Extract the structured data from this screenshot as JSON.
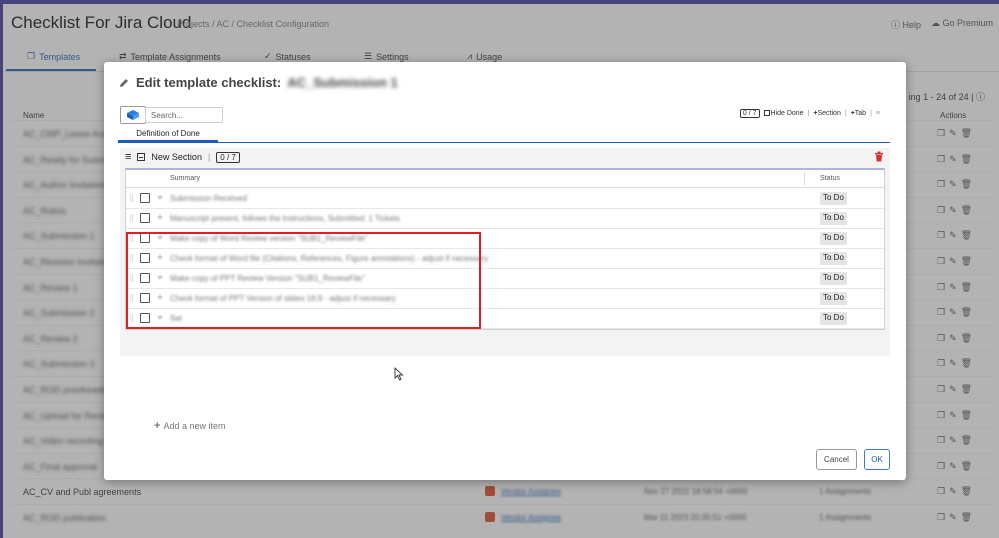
{
  "app": {
    "title": "Checklist For Jira Cloud",
    "breadcrumb": "Projects / AC / Checklist Configuration",
    "help_label": "Help",
    "premium_label": "Go Premium"
  },
  "tabs": [
    {
      "label": "Templates",
      "icon": "copy-icon"
    },
    {
      "label": "Template Assignments",
      "icon": "arrows-icon"
    },
    {
      "label": "Statuses",
      "icon": "check-circle-icon"
    },
    {
      "label": "Settings",
      "icon": "sliders-icon"
    },
    {
      "label": "Usage",
      "icon": "chart-icon"
    }
  ],
  "list": {
    "pager": "ing 1 - 24 of 24",
    "col_name": "Name",
    "col_actions": "Actions",
    "rows": [
      {
        "name": "AC_CMP_Lease Assets"
      },
      {
        "name": "AC_Ready for Submission"
      },
      {
        "name": "AC_Author Invitation"
      },
      {
        "name": "AC_Rubric"
      },
      {
        "name": "AC_Submission 1"
      },
      {
        "name": "AC_Revision Invitation"
      },
      {
        "name": "AC_Review 1"
      },
      {
        "name": "AC_Submission 2"
      },
      {
        "name": "AC_Review 2"
      },
      {
        "name": "AC_Submission 3"
      },
      {
        "name": "AC_ROD proofreading"
      },
      {
        "name": "AC_Upload for Review"
      },
      {
        "name": "AC_Video recording"
      },
      {
        "name": "AC_Final approval"
      },
      {
        "name": "AC_CV and Publ agreements",
        "clear": true,
        "extra1": "Vendor Assignee",
        "extra2": "Nov 27 2022 18:58:54 +0000",
        "extra3": "1 Assignments"
      },
      {
        "name": "AC_ROD publication",
        "extra1": "Vendor Assignee",
        "extra2": "Mar 11 2023 20:35:51 +0000",
        "extra3": "1 Assignments"
      }
    ]
  },
  "modal": {
    "title_prefix": "Edit template checklist:",
    "template_name": "AC_Submission 1",
    "search_placeholder": "Search...",
    "count": "0 / 7",
    "hide_done": "Hide Done",
    "section_btn": "Section",
    "tab_btn": "Tab",
    "dod_tab": "Definition of Done",
    "section_title": "New Section",
    "section_count": "0 / 7",
    "col_summary": "Summary",
    "col_status": "Status",
    "items": [
      {
        "summary": "Submission Received",
        "status": "To Do"
      },
      {
        "summary": "Manuscript present, follows the Instructions, Submitted: 1 Tickets",
        "status": "To Do"
      },
      {
        "summary": "Make copy of Word Review version \"SUB1_ReviewFile\"",
        "status": "To Do"
      },
      {
        "summary": "Check format of Word file (Citations, References, Figure annotations) - adjust if necessary",
        "status": "To Do"
      },
      {
        "summary": "Make copy of PPT Review Version \"SUB1_ReviewFile\"",
        "status": "To Do"
      },
      {
        "summary": "Check format of PPT Version of slides 16:9 - adjust if necessary",
        "status": "To Do"
      },
      {
        "summary": "Set",
        "status": "To Do"
      }
    ],
    "add_item": "Add a new item",
    "cancel": "Cancel",
    "ok": "OK"
  },
  "colors": {
    "accent": "#1a5fb4",
    "brand_bar": "#3f3b9a",
    "highlight": "#e0201e",
    "delete": "#d9302c"
  }
}
